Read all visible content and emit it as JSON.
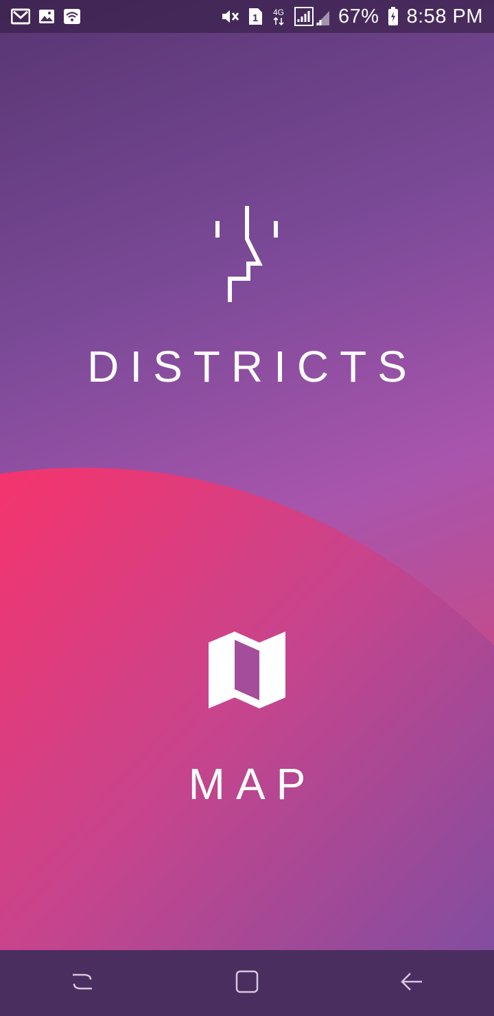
{
  "status_bar": {
    "battery_percent": "67%",
    "time": "8:58 PM",
    "network": "4G",
    "sim": "1",
    "icons": [
      "gmail-icon",
      "gallery-icon",
      "wifi-icon",
      "mute-icon",
      "sim-1-icon",
      "signal-icon",
      "battery-icon"
    ]
  },
  "menu": {
    "districts_label": "DISTRICTS",
    "map_label": "MAP"
  },
  "nav_bar": {
    "icons": [
      "recent-apps-icon",
      "home-icon",
      "back-icon"
    ]
  },
  "colors": {
    "background_start": "#573572",
    "background_mid": "#a855ad",
    "wave_pink": "#f0356e",
    "nav_bar": "#4a2e5f"
  }
}
